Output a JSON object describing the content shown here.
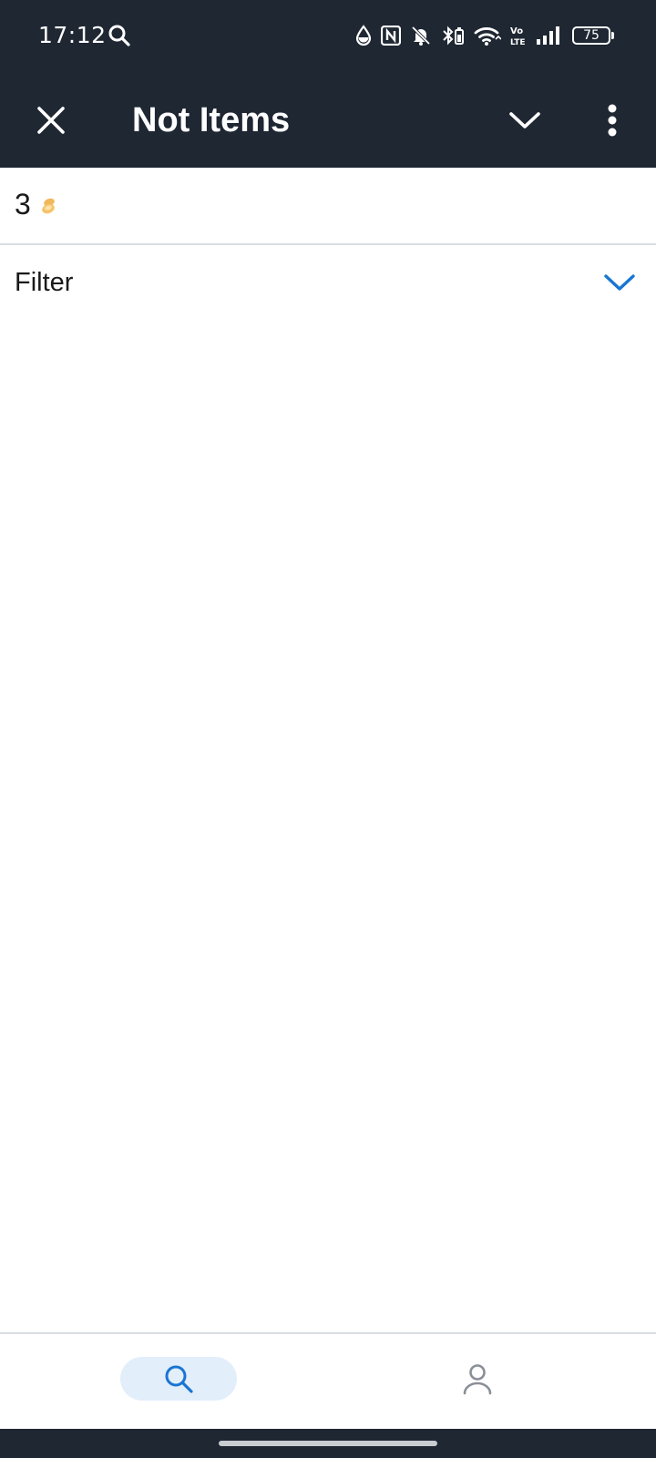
{
  "status_bar": {
    "time": "17:12",
    "battery_level": "75",
    "network_label": "Vo LTE",
    "icons": [
      "search-icon",
      "data-saver-icon",
      "nfc-icon",
      "bell-off-icon",
      "bluetooth-icon",
      "wifi-icon",
      "volte-icon",
      "signal-icon",
      "battery-icon"
    ]
  },
  "app_bar": {
    "title": "Not Items",
    "close_icon": "close-icon",
    "dropdown_icon": "chevron-down-icon",
    "menu_icon": "more-vert-icon"
  },
  "count_row": {
    "value": "3",
    "icon": "coin-icon"
  },
  "filter": {
    "label": "Filter",
    "icon": "chevron-down-icon"
  },
  "bottom_nav": {
    "items": [
      {
        "icon": "search-icon",
        "active": true
      },
      {
        "icon": "profile-icon",
        "active": false
      }
    ]
  },
  "colors": {
    "header_bg": "#1f2733",
    "accent": "#1976d2",
    "nav_active_bg": "#e3eefb",
    "coin": "#f5c36b"
  }
}
